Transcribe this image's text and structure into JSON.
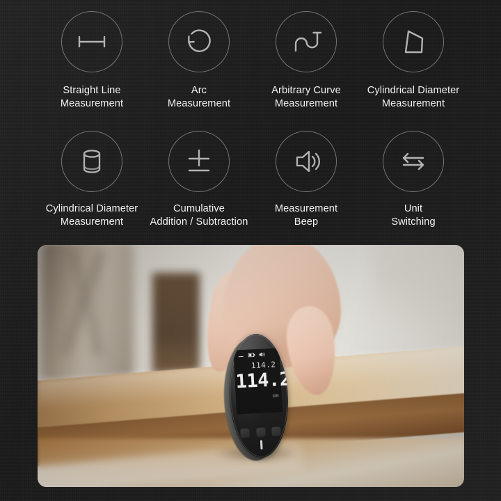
{
  "page": {
    "background_color": "#1c1c1c",
    "text_color": "#f2f2f2"
  },
  "features": {
    "rows": [
      {
        "items": [
          {
            "icon": "straight-line-measure-icon",
            "label_line1": "Straight Line",
            "label_line2": "Measurement"
          },
          {
            "icon": "arc-measure-icon",
            "label_line1": "Arc",
            "label_line2": "Measurement"
          },
          {
            "icon": "arbitrary-curve-icon",
            "label_line1": "Arbitrary Curve",
            "label_line2": "Measurement"
          },
          {
            "icon": "trapezoid-diameter-icon",
            "label_line1": "Cylindrical Diameter",
            "label_line2": "Measurement"
          }
        ]
      },
      {
        "items": [
          {
            "icon": "cylinder-icon",
            "label_line1": "Cylindrical Diameter",
            "label_line2": "Measurement"
          },
          {
            "icon": "plus-minus-icon",
            "label_line1": "Cumulative",
            "label_line2": "Addition / Subtraction"
          },
          {
            "icon": "speaker-icon",
            "label_line1": "Measurement",
            "label_line2": "Beep"
          },
          {
            "icon": "swap-arrows-icon",
            "label_line1": "Unit",
            "label_line2": "Switching"
          }
        ]
      }
    ]
  },
  "photo": {
    "caption": "Hand placing round digital measuring device on wooden table",
    "device": {
      "screen": {
        "memory_value": "114.2",
        "main_value": "114.2",
        "unit": "cm",
        "minus_indicator": "-",
        "battery_icon": "battery-icon",
        "sound_icon": "speaker-small-icon"
      }
    }
  }
}
